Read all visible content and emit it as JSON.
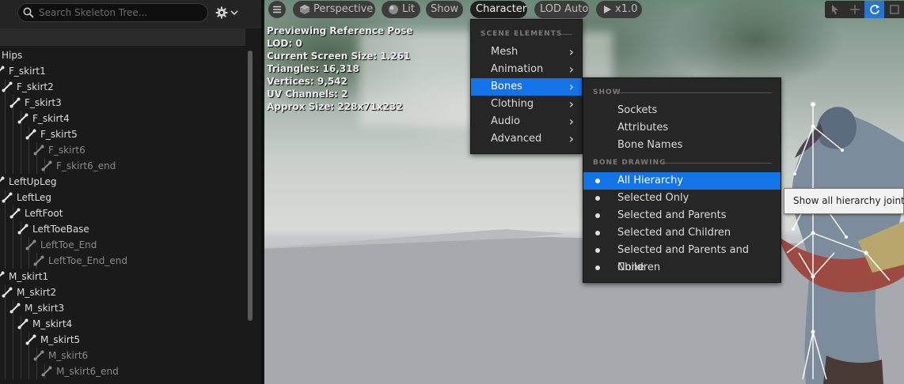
{
  "skeleton_tree": {
    "search_placeholder": "Search Skeleton Tree...",
    "settings_icon": "gear-icon",
    "rows": [
      {
        "label": "Hips",
        "depth": 0,
        "dim": false
      },
      {
        "label": "F_skirt1",
        "depth": 0,
        "dim": false
      },
      {
        "label": "F_skirt2",
        "depth": 1,
        "dim": false
      },
      {
        "label": "F_skirt3",
        "depth": 2,
        "dim": false
      },
      {
        "label": "F_skirt4",
        "depth": 3,
        "dim": false
      },
      {
        "label": "F_skirt5",
        "depth": 4,
        "dim": false
      },
      {
        "label": "F_skirt6",
        "depth": 5,
        "dim": true
      },
      {
        "label": "F_skirt6_end",
        "depth": 6,
        "dim": true
      },
      {
        "label": "LeftUpLeg",
        "depth": 0,
        "dim": false
      },
      {
        "label": "LeftLeg",
        "depth": 1,
        "dim": false
      },
      {
        "label": "LeftFoot",
        "depth": 2,
        "dim": false
      },
      {
        "label": "LeftToeBase",
        "depth": 3,
        "dim": false
      },
      {
        "label": "LeftToe_End",
        "depth": 4,
        "dim": true
      },
      {
        "label": "LeftToe_End_end",
        "depth": 5,
        "dim": true
      },
      {
        "label": "M_skirt1",
        "depth": 0,
        "dim": false
      },
      {
        "label": "M_skirt2",
        "depth": 1,
        "dim": false
      },
      {
        "label": "M_skirt3",
        "depth": 2,
        "dim": false
      },
      {
        "label": "M_skirt4",
        "depth": 3,
        "dim": false
      },
      {
        "label": "M_skirt5",
        "depth": 4,
        "dim": false
      },
      {
        "label": "M_skirt6",
        "depth": 5,
        "dim": true
      },
      {
        "label": "M_skirt6_end",
        "depth": 6,
        "dim": true
      }
    ]
  },
  "viewport": {
    "toolbar": {
      "menu_icon": "hamburger-icon",
      "perspective": "Perspective",
      "lit": "Lit",
      "show": "Show",
      "character": "Character",
      "lod": "LOD Auto",
      "speed": "x1.0"
    },
    "stats": [
      "Previewing Reference Pose",
      "LOD: 0",
      "Current Screen Size: 1.261",
      "Triangles: 16,318",
      "Vertices: 9,542",
      "UV Channels: 2",
      "Approx Size: 228x71x232"
    ]
  },
  "character_menu": {
    "section": "SCENE ELEMENTS",
    "items": [
      "Mesh",
      "Animation",
      "Bones",
      "Clothing",
      "Audio",
      "Advanced"
    ],
    "highlighted": "Bones"
  },
  "bones_submenu": {
    "show_header": "SHOW",
    "show_items": [
      "Sockets",
      "Attributes",
      "Bone Names"
    ],
    "drawing_header": "BONE DRAWING",
    "drawing_items": [
      "All Hierarchy",
      "Selected Only",
      "Selected and Parents",
      "Selected and Children",
      "Selected and Parents and Children",
      "None"
    ],
    "selected": "All Hierarchy"
  },
  "tooltip": "Show all hierarchy joints",
  "colors": {
    "highlight": "#1473e6",
    "menu_bg": "#262626",
    "panel_bg": "#1a1a1a"
  }
}
